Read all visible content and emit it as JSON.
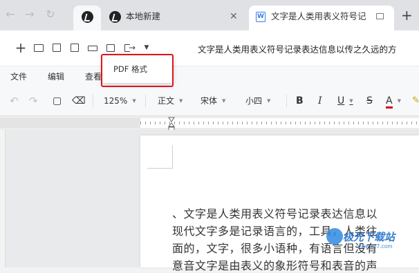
{
  "browser": {
    "tabs": [
      {
        "label": "本地新建"
      },
      {
        "label": "文字是人类用表义符号记"
      }
    ],
    "new_tab": "+"
  },
  "doc_header": {
    "title": "文字是人类用表义符号记录表达信息以传之久远的方"
  },
  "menu": {
    "items": [
      "文件",
      "编辑",
      "查看"
    ]
  },
  "toolbar": {
    "zoom": "125%",
    "style": "正文",
    "font": "宋体",
    "size": "小四",
    "bold": "B",
    "italic": "I",
    "underline": "U",
    "strike": "S",
    "font_color": "A"
  },
  "export_menu": {
    "option": "PDF 格式"
  },
  "document": {
    "lines": [
      "、文字是人类用表义符号记录表达信息以",
      "现代文字多是记录语言的，工具，人类往",
      "面的，文字，很多小语种，有语言但没有",
      "意音文字是由表义的象形符号和表音的声"
    ]
  },
  "watermark": {
    "text": "极光下载站",
    "sub": "www.xz7.com"
  },
  "colors": {
    "highlight_border": "#e0141a",
    "font_color_bar": "#d0021b",
    "watermark": "#1d6fc8"
  }
}
